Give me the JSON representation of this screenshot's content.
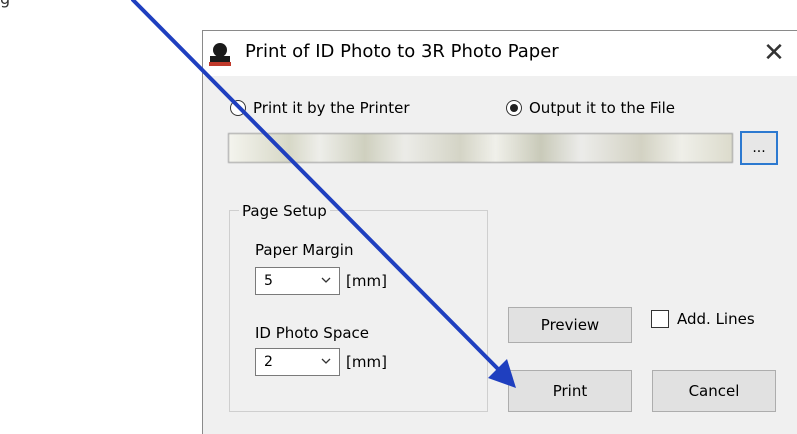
{
  "top_text": "g",
  "dialog": {
    "title": "Print of ID Photo to 3R Photo Paper",
    "close_glyph": "✕",
    "radio_printer": {
      "label": "Print it by the Printer",
      "selected": false
    },
    "radio_file": {
      "label": "Output it to the File",
      "selected": true
    },
    "browse_label": "...",
    "page_setup": {
      "legend": "Page Setup",
      "paper_margin_label": "Paper Margin",
      "paper_margin_value": "5",
      "paper_margin_unit": "[mm]",
      "id_photo_space_label": "ID Photo Space",
      "id_photo_space_value": "2",
      "id_photo_space_unit": "[mm]"
    },
    "preview_label": "Preview",
    "add_lines_label": "Add. Lines",
    "print_label": "Print",
    "cancel_label": "Cancel"
  },
  "colors": {
    "arrow": "#1f3fbf",
    "focus_border": "#2c79d0",
    "dialog_bg": "#f0f0f0"
  },
  "icons": {
    "app": "id-photo-person-icon",
    "close": "close-icon",
    "combo": "chevron-down-icon"
  }
}
